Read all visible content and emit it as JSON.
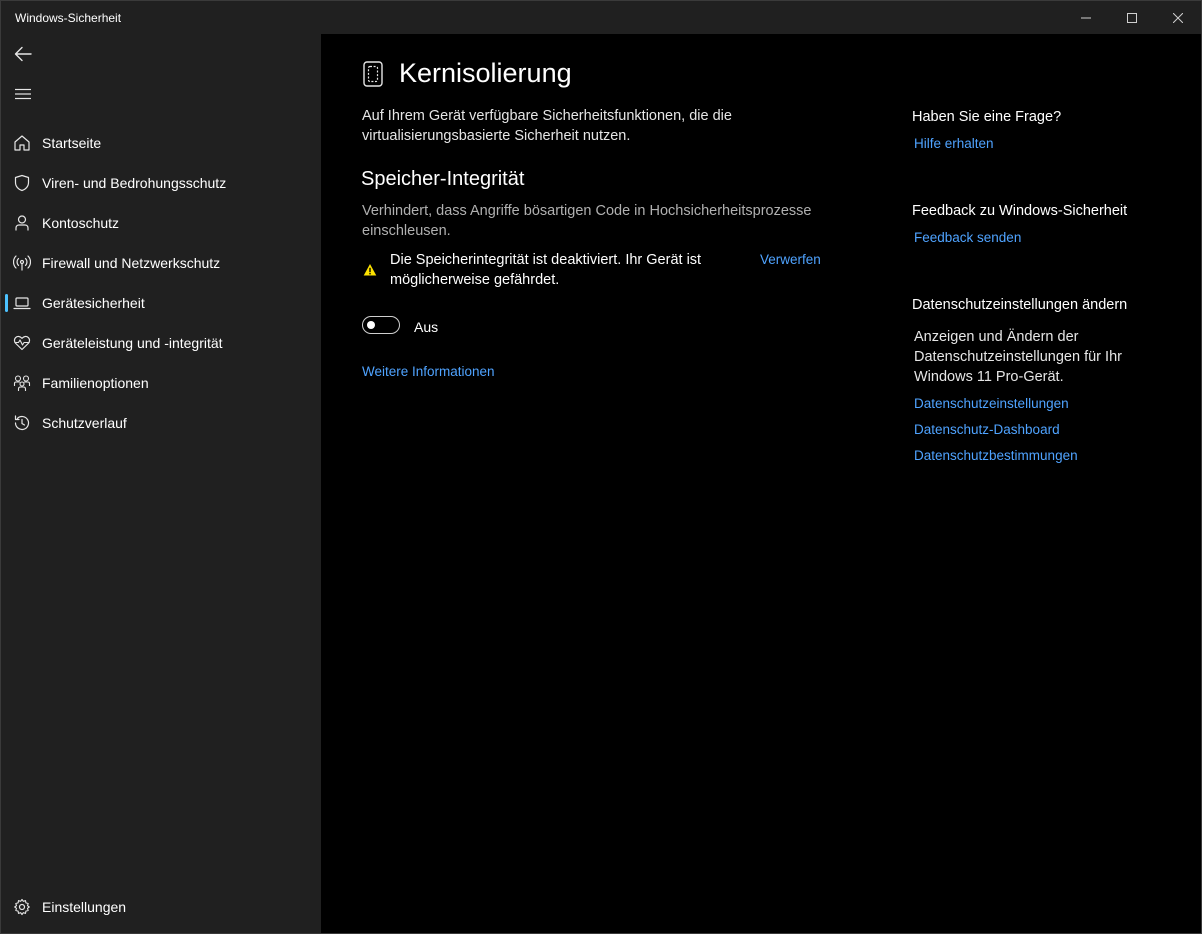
{
  "window": {
    "title": "Windows-Sicherheit",
    "controls": [
      "minimize-icon",
      "maximize-icon",
      "close-icon"
    ]
  },
  "sidebar": {
    "back_icon": "back-arrow-icon",
    "menu_icon": "hamburger-menu-icon",
    "items": [
      {
        "label": "Startseite",
        "icon": "home-icon",
        "selected": false
      },
      {
        "label": "Viren- und Bedrohungsschutz",
        "icon": "shield-icon",
        "selected": false
      },
      {
        "label": "Kontoschutz",
        "icon": "person-icon",
        "selected": false
      },
      {
        "label": "Firewall und Netzwerkschutz",
        "icon": "antenna-icon",
        "selected": false
      },
      {
        "label": "Gerätesicherheit",
        "icon": "laptop-icon",
        "selected": true
      },
      {
        "label": "Geräteleistung und -integrität",
        "icon": "heart-pulse-icon",
        "selected": false
      },
      {
        "label": "Familienoptionen",
        "icon": "family-icon",
        "selected": false
      },
      {
        "label": "Schutzverlauf",
        "icon": "history-icon",
        "selected": false
      }
    ],
    "settings": {
      "label": "Einstellungen",
      "icon": "gear-icon"
    }
  },
  "main": {
    "page_icon": "core-isolation-chip-icon",
    "title": "Kernisolierung",
    "intro": "Auf Ihrem Gerät verfügbare Sicherheitsfunktionen, die die virtualisierungsbasierte Sicherheit nutzen.",
    "memory_integrity": {
      "title": "Speicher-Integrität",
      "description": "Verhindert, dass Angriffe bösartigen Code in Hochsicherheitsprozesse einschleusen.",
      "warning_icon": "warning-triangle-icon",
      "warning": "Die Speicherintegrität ist deaktiviert. Ihr Gerät ist möglicherweise gefährdet.",
      "dismiss": "Verwerfen",
      "toggle_on": false,
      "toggle_label": "Aus",
      "more_info": "Weitere Informationen"
    }
  },
  "right_column": {
    "question_heading": "Haben Sie eine Frage?",
    "help_link": "Hilfe erhalten",
    "feedback_heading": "Feedback zu Windows-Sicherheit",
    "feedback_link": "Feedback senden",
    "privacy_heading": "Datenschutzeinstellungen ändern",
    "privacy_text": "Anzeigen und Ändern der Datenschutzeinstellungen für Ihr Windows 11 Pro-Gerät.",
    "privacy_links": [
      "Datenschutzeinstellungen",
      "Datenschutz-Dashboard",
      "Datenschutzbestimmungen"
    ]
  },
  "colors": {
    "accent": "#4cc2ff",
    "link": "#4fa3ff",
    "warning": "#fce100",
    "sidebar_bg": "#202020",
    "content_bg": "#000000"
  }
}
